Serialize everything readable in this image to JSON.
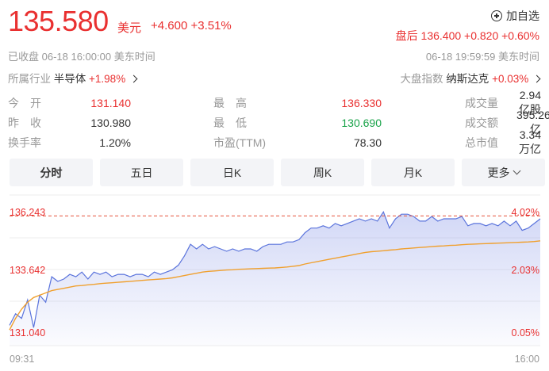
{
  "header": {
    "price": "135.580",
    "currency": "美元",
    "change": "+4.600 +3.51%",
    "add_watchlist": "加自选",
    "after_hours": "盘后 136.400 +0.820 +0.60%",
    "status": "已收盘  06-18 16:00:00  美东时间",
    "after_hours_time": "06-18 19:59:59  美东时间",
    "industry_label": "所属行业",
    "industry_name": "半导体",
    "industry_change": "+1.98%",
    "index_label": "大盘指数",
    "index_name": "纳斯达克",
    "index_change": "+0.03%"
  },
  "stats": [
    [
      {
        "label": "今　开",
        "value": "131.140",
        "color": "#e93030"
      },
      {
        "label": "最　高",
        "value": "136.330",
        "color": "#e93030"
      },
      {
        "label": "成交量",
        "value": "2.94亿股",
        "color": "#333333"
      }
    ],
    [
      {
        "label": "昨　收",
        "value": "130.980",
        "color": "#333333"
      },
      {
        "label": "最　低",
        "value": "130.690",
        "color": "#1aa34a"
      },
      {
        "label": "成交额",
        "value": "395.26亿",
        "color": "#333333"
      }
    ],
    [
      {
        "label": "换手率",
        "value": "1.20%",
        "color": "#333333"
      },
      {
        "label": "市盈(TTM)",
        "value": "78.30",
        "color": "#333333"
      },
      {
        "label": "总市值",
        "value": "3.34万亿",
        "color": "#333333"
      }
    ]
  ],
  "tabs": [
    {
      "label": "分时",
      "active": true
    },
    {
      "label": "五日"
    },
    {
      "label": "日K"
    },
    {
      "label": "周K"
    },
    {
      "label": "月K"
    },
    {
      "label": "更多"
    }
  ],
  "chart_data": {
    "type": "line",
    "y_left_labels": [
      "136.243",
      "133.642",
      "131.040"
    ],
    "y_right_labels": [
      "4.02%",
      "2.03%",
      "0.05%"
    ],
    "x_labels": [
      "09:31",
      "16:00"
    ],
    "ylim": [
      131.04,
      136.243
    ],
    "prev_close": 130.98,
    "reference_line": 135.58,
    "colors": {
      "price": "#5b74dc",
      "average": "#f0a02e",
      "reference": "#e5533d"
    },
    "series": [
      {
        "values": [
          131.3,
          131.8,
          131.6,
          132.4,
          131.2,
          132.6,
          132.3,
          133.4,
          133.2,
          133.3,
          133.5,
          133.4,
          133.6,
          133.3,
          133.6,
          133.5,
          133.6,
          133.4,
          133.5,
          133.5,
          133.4,
          133.5,
          133.5,
          133.4,
          133.6,
          133.5,
          133.6,
          133.7,
          133.9,
          134.3,
          134.8,
          134.6,
          134.8,
          134.6,
          134.7,
          134.6,
          134.5,
          134.6,
          134.5,
          134.6,
          134.6,
          134.5,
          134.7,
          134.8,
          134.8,
          134.8,
          134.9,
          134.9,
          135.0,
          135.3,
          135.5,
          135.5,
          135.6,
          135.5,
          135.7,
          135.6,
          135.7,
          135.8,
          135.9,
          135.8,
          135.9,
          135.8,
          136.2,
          135.5,
          135.9,
          136.1,
          136.1,
          136.0,
          135.8,
          135.8,
          136.0,
          135.8,
          135.9,
          135.9,
          135.9,
          136.0,
          135.6,
          135.7,
          135.7,
          135.6,
          135.7,
          135.6,
          135.8,
          135.6,
          135.8,
          135.4,
          135.5,
          135.7,
          135.9
        ]
      },
      {
        "values": [
          131.1,
          131.6,
          132.0,
          132.3,
          132.5,
          132.6,
          132.7,
          132.8,
          132.85,
          132.9,
          132.95,
          133.0,
          133.02,
          133.05,
          133.07,
          133.1,
          133.12,
          133.14,
          133.16,
          133.18,
          133.2,
          133.22,
          133.24,
          133.26,
          133.28,
          133.3,
          133.32,
          133.35,
          133.4,
          133.45,
          133.5,
          133.55,
          133.6,
          133.63,
          133.65,
          133.67,
          133.69,
          133.7,
          133.72,
          133.73,
          133.74,
          133.75,
          133.76,
          133.77,
          133.78,
          133.8,
          133.82,
          133.85,
          133.88,
          133.95,
          134.0,
          134.05,
          134.1,
          134.15,
          134.2,
          134.25,
          134.3,
          134.35,
          134.4,
          134.45,
          134.48,
          134.5,
          134.52,
          134.55,
          134.57,
          134.6,
          134.62,
          134.64,
          134.66,
          134.68,
          134.7,
          134.72,
          134.73,
          134.75,
          134.76,
          134.78,
          134.8,
          134.81,
          134.82,
          134.83,
          134.84,
          134.85,
          134.86,
          134.87,
          134.88,
          134.89,
          134.9,
          134.92,
          134.95
        ]
      }
    ]
  }
}
